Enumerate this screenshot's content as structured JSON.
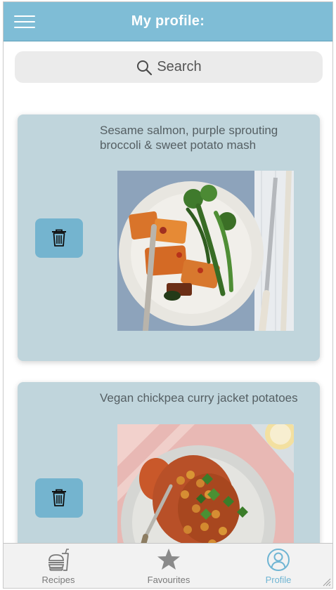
{
  "header": {
    "title": "My profile:",
    "menu_icon": "hamburger-menu-icon",
    "color": "#7fbdd6"
  },
  "search": {
    "placeholder": "Search",
    "icon": "search-icon"
  },
  "recipes": [
    {
      "title": "Sesame salmon, purple sprouting broccoli & sweet potato mash",
      "delete_icon": "trash-icon",
      "image": "salmon-broccoli-plate"
    },
    {
      "title": "Vegan chickpea curry jacket potatoes",
      "delete_icon": "trash-icon",
      "image": "chickpea-curry-plate"
    }
  ],
  "tabs": [
    {
      "label": "Recipes",
      "icon": "food-burger-drink-icon",
      "active": false
    },
    {
      "label": "Favourites",
      "icon": "star-icon",
      "active": false
    },
    {
      "label": "Profile",
      "icon": "user-circle-icon",
      "active": true
    }
  ],
  "colors": {
    "card_bg": "#c0d5dc",
    "delete_button": "#74b4cf",
    "active_tab": "#6fb5d3"
  }
}
